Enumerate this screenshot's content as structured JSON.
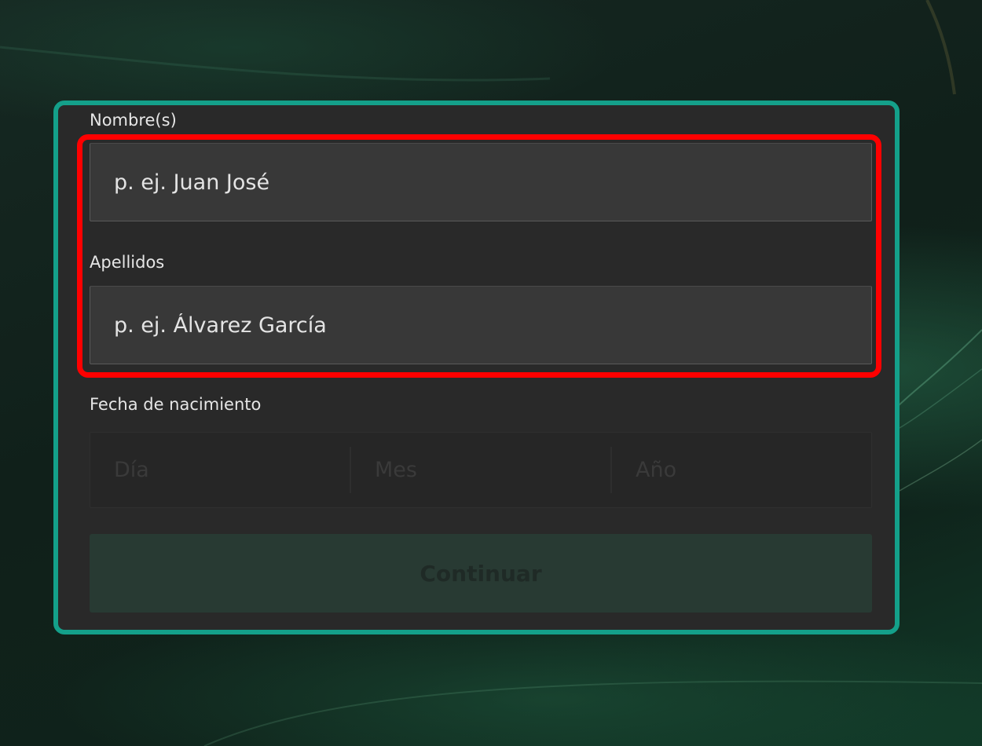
{
  "form": {
    "first_name": {
      "label": "Nombre(s)",
      "placeholder": "p. ej. Juan José",
      "value": ""
    },
    "last_name": {
      "label": "Apellidos",
      "placeholder": "p. ej. Álvarez García",
      "value": ""
    },
    "birth_date": {
      "label": "Fecha de nacimiento",
      "day_placeholder": "Día",
      "month_placeholder": "Mes",
      "year_placeholder": "Año"
    },
    "continue_label": "Continuar"
  },
  "colors": {
    "card_border": "#14a08a",
    "highlight_border": "#ff0000",
    "card_background": "#292929",
    "input_background": "#383838",
    "button_background": "#283a33"
  }
}
